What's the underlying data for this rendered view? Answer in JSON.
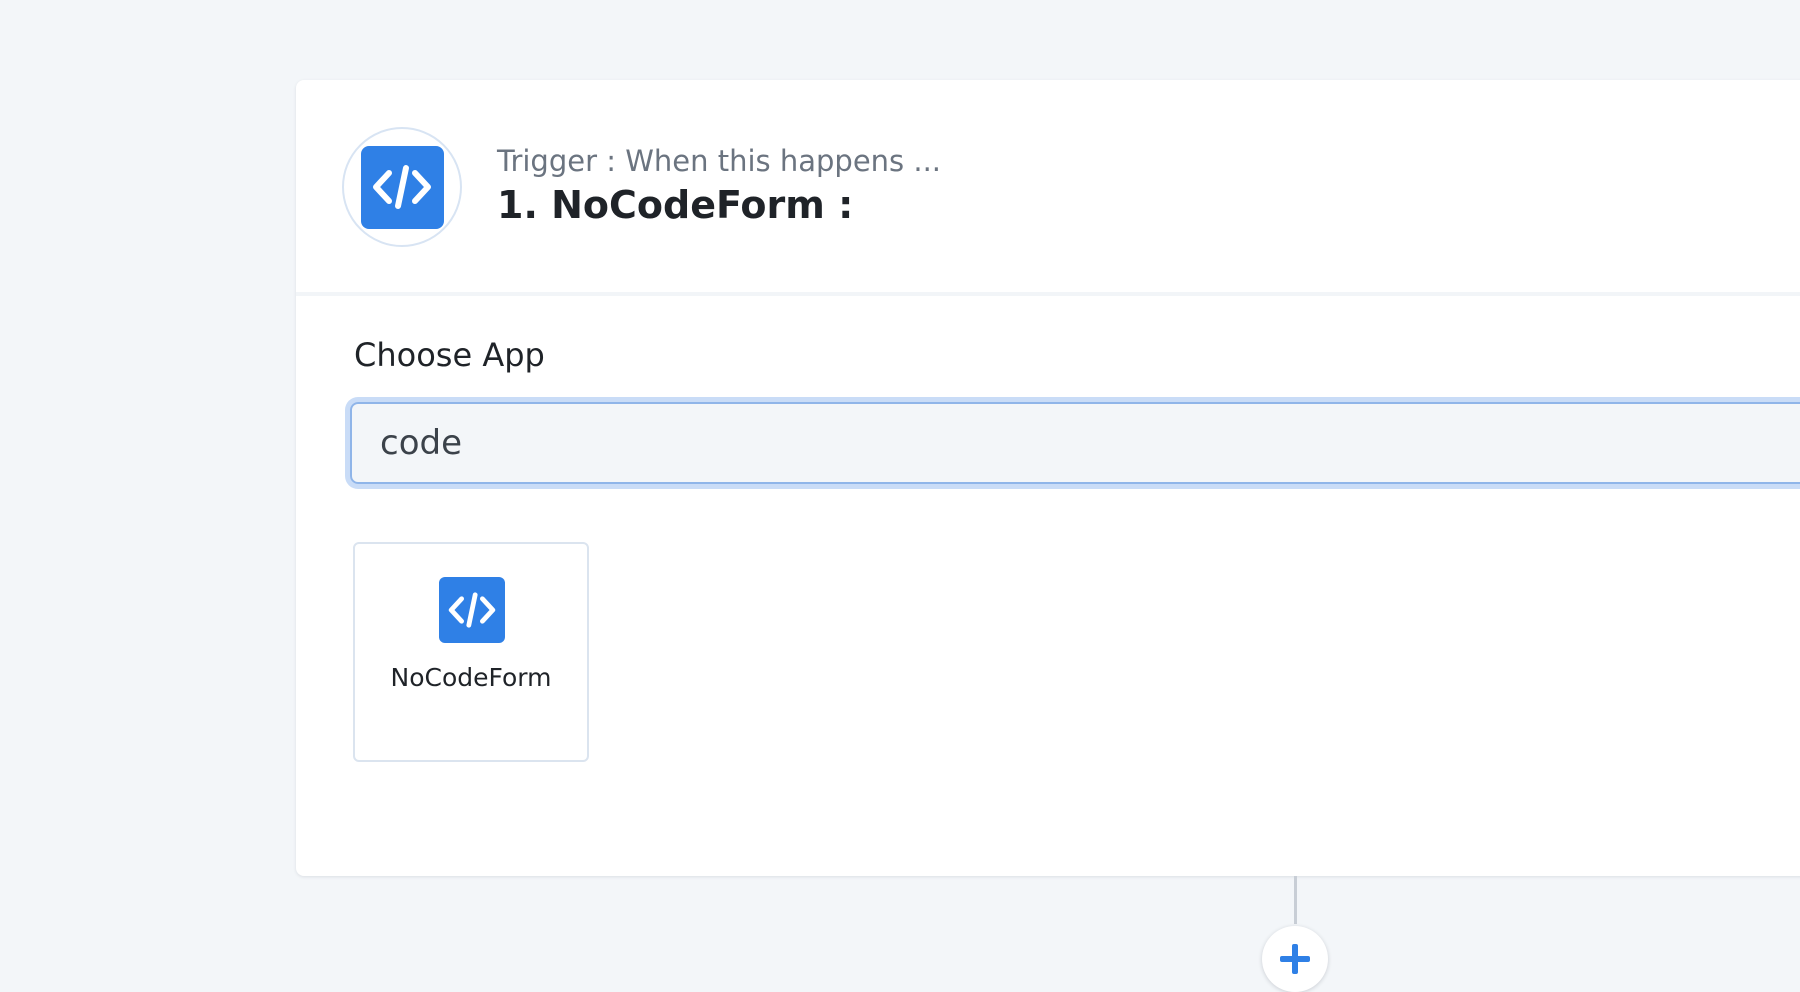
{
  "trigger": {
    "app_icon": "code-brackets-icon",
    "subtitle": "Trigger : When this happens ...",
    "title": "1. NoCodeForm :"
  },
  "choose_app": {
    "label": "Choose App",
    "search_value": "code"
  },
  "results": [
    {
      "icon": "code-brackets-icon",
      "label": "NoCodeForm"
    }
  ],
  "add_step": {
    "icon": "plus-icon"
  },
  "colors": {
    "background": "#f3f6f9",
    "card": "#ffffff",
    "accent": "#2f80e6",
    "input_focus_border": "#8fb5e9",
    "text_primary": "#1f2328",
    "text_secondary": "#6b7480"
  }
}
